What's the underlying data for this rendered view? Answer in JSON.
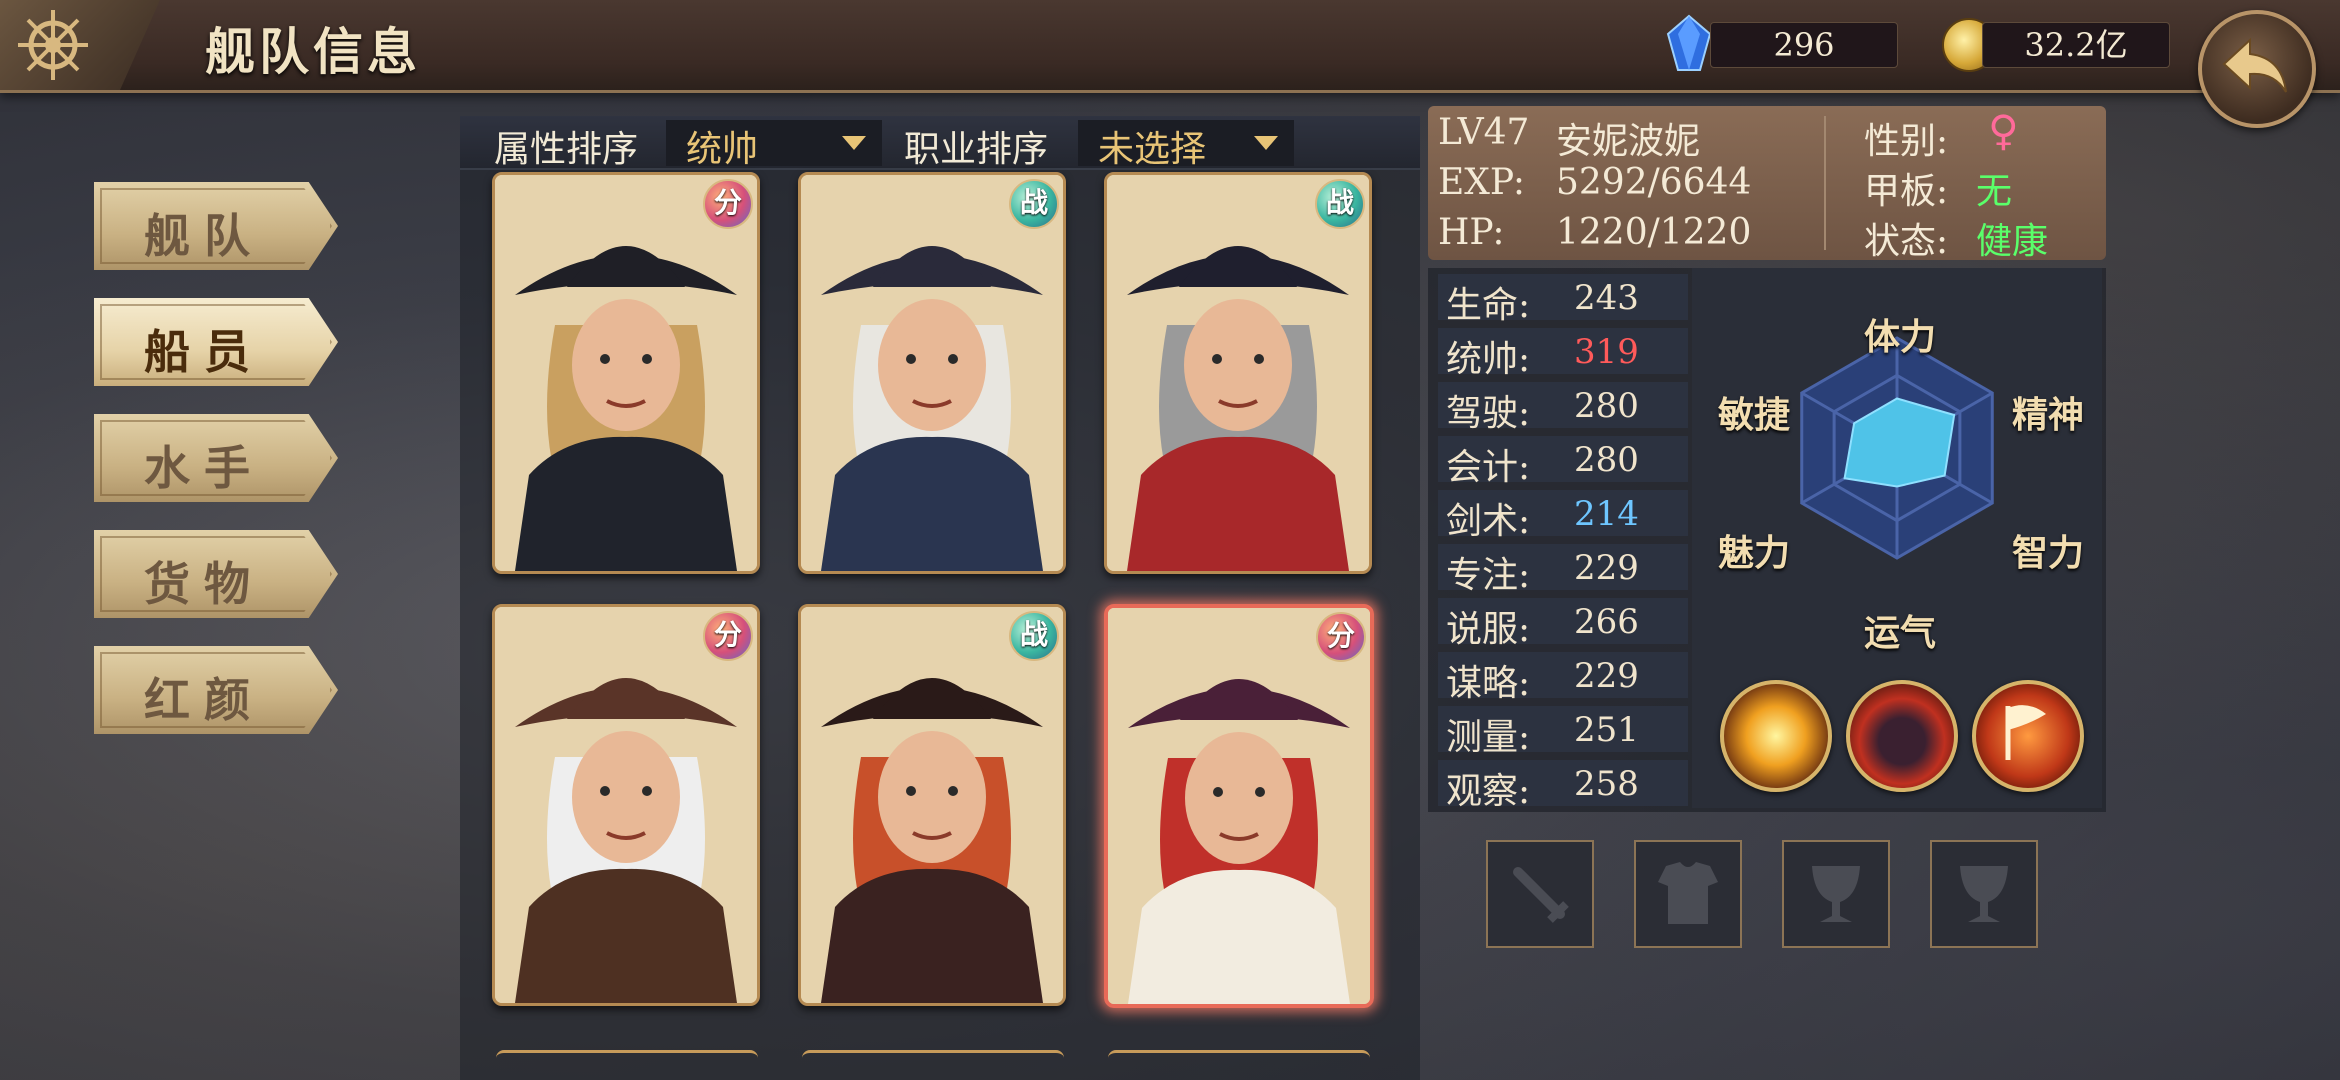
{
  "header": {
    "title": "舰队信息",
    "gems": "296",
    "gold": "32.2亿"
  },
  "menu": [
    {
      "label": "舰队",
      "active": false
    },
    {
      "label": "船员",
      "active": true
    },
    {
      "label": "水手",
      "active": false
    },
    {
      "label": "货物",
      "active": false
    },
    {
      "label": "红颜",
      "active": false
    }
  ],
  "filters": {
    "attr_label": "属性排序",
    "attr_value": "统帅",
    "job_label": "职业排序",
    "job_value": "未选择"
  },
  "cards": [
    {
      "badge": "分",
      "hair": "#c9a060",
      "hat": "#1f1f26",
      "coat": "#20232c",
      "selected": false
    },
    {
      "badge": "战",
      "hair": "#e8e6e0",
      "hat": "#2a2a3a",
      "coat": "#2a3550",
      "selected": false
    },
    {
      "badge": "战",
      "hair": "#9a9a9a",
      "hat": "#1f1f2e",
      "coat": "#a8282a",
      "selected": false
    },
    {
      "badge": "分",
      "hair": "#eeeeee",
      "hat": "#5a3428",
      "coat": "#4e3022",
      "selected": false
    },
    {
      "badge": "战",
      "hair": "#c8502a",
      "hat": "#2a1a18",
      "coat": "#3a2220",
      "selected": false
    },
    {
      "badge": "分",
      "hair": "#c0302a",
      "hat": "#4a2038",
      "coat": "#f2ece0",
      "selected": true
    }
  ],
  "character": {
    "level": "LV47",
    "name": "安妮波妮",
    "exp_label": "EXP:",
    "exp": "5292/6644",
    "hp_label": "HP:",
    "hp": "1220/1220",
    "gender_label": "性别:",
    "gender": "♀",
    "deck_label": "甲板:",
    "deck": "无",
    "status_label": "状态:",
    "status": "健康"
  },
  "stats": [
    {
      "label": "生命:",
      "value": "243",
      "color": "#f0e4cc"
    },
    {
      "label": "统帅:",
      "value": "319",
      "color": "#ff5a5a"
    },
    {
      "label": "驾驶:",
      "value": "280",
      "color": "#f0e4cc"
    },
    {
      "label": "会计:",
      "value": "280",
      "color": "#f0e4cc"
    },
    {
      "label": "剑术:",
      "value": "214",
      "color": "#6ec6ff"
    },
    {
      "label": "专注:",
      "value": "229",
      "color": "#f0e4cc"
    },
    {
      "label": "说服:",
      "value": "266",
      "color": "#f0e4cc"
    },
    {
      "label": "谋略:",
      "value": "229",
      "color": "#f0e4cc"
    },
    {
      "label": "测量:",
      "value": "251",
      "color": "#f0e4cc"
    },
    {
      "label": "观察:",
      "value": "258",
      "color": "#f0e4cc"
    }
  ],
  "radar": {
    "labels": [
      "体力",
      "精神",
      "智力",
      "运气",
      "魅力",
      "敏捷"
    ],
    "values": [
      0.45,
      0.6,
      0.5,
      0.35,
      0.55,
      0.45
    ]
  },
  "skills": [
    "sun-burst-skill",
    "pirate-hat-skill",
    "flag-skill"
  ],
  "equipment": [
    "sword-slot",
    "armor-slot",
    "cup-slot",
    "cup-slot"
  ],
  "colors": {
    "gender": "#ff6a9a",
    "deck": "#5aff6a",
    "status": "#5aff6a",
    "accent": "#e8c476"
  }
}
